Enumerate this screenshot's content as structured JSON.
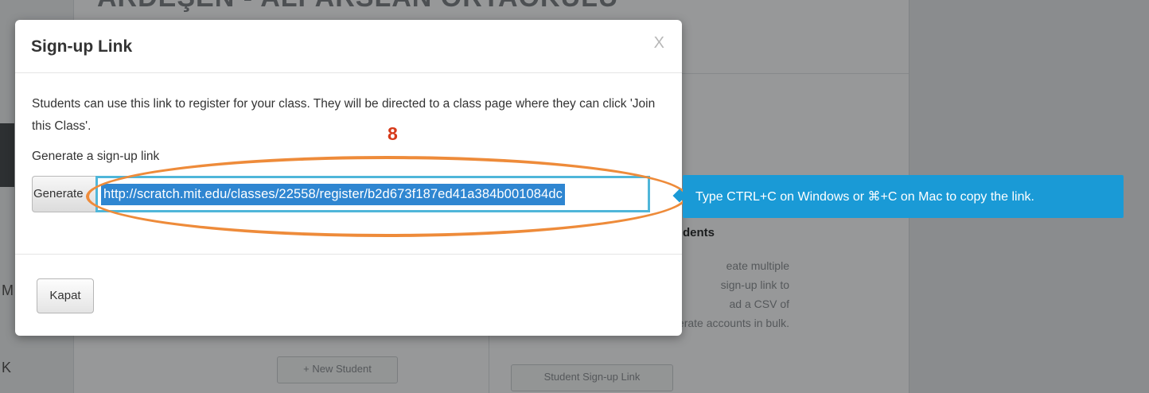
{
  "background": {
    "class_title": "ARDEŞEN - ALPARSLAN ORTAOKULU",
    "side_letters": [
      "M",
      "K"
    ],
    "section_heading": "dents",
    "description_lines": [
      "eate multiple",
      "sign-up link to",
      "ad a CSV of",
      "accounts to generate accounts in bulk."
    ],
    "new_student_button": "+ New Student",
    "student_signup_button": "Student Sign-up Link"
  },
  "modal": {
    "title": "Sign-up Link",
    "close_label": "X",
    "description": "Students can use this link to register for your class. They will be directed to a class page where they can click 'Join this Class'.",
    "generate_label": "Generate a sign-up link",
    "generate_button": "Generate",
    "signup_url": "http://scratch.mit.edu/classes/22558/register/b2d673f187ed41a384b001084dc",
    "close_button": "Kapat"
  },
  "annotation": {
    "step_number": "8",
    "ellipse_color": "#ee8b3a"
  },
  "tooltip": {
    "text": "Type CTRL+C on Windows or ⌘+C on Mac to copy the link.",
    "color": "#1a9ad6"
  },
  "colors": {
    "selection": "#2f86d1",
    "field_border": "#4fb6d9",
    "step_marker": "#d63a1a"
  }
}
